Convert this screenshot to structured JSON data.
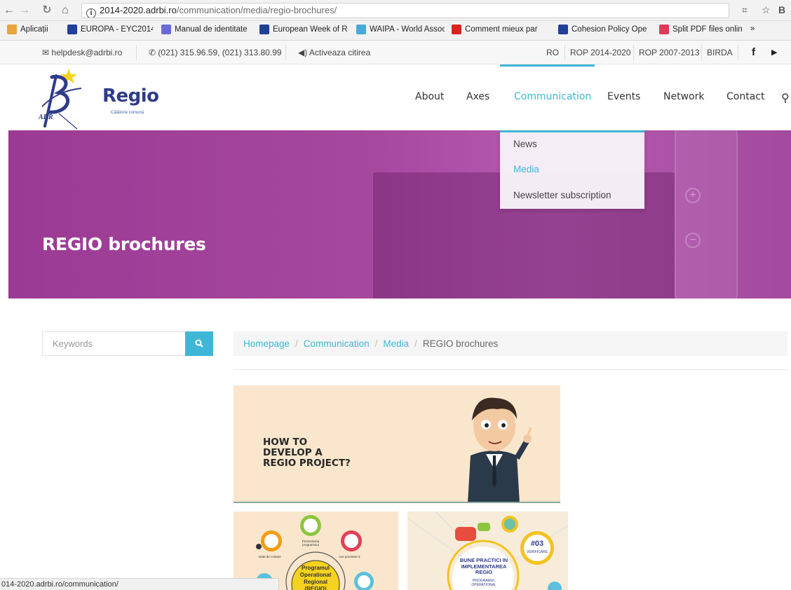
{
  "browser": {
    "url_host": "2014-2020.adrbi.ro",
    "url_path": "/communication/media/regio-brochures/",
    "bookmarks": [
      {
        "label": "Aplicații",
        "color": "#e8a53a"
      },
      {
        "label": "EUROPA - EYC2014 -",
        "color": "#1f3f99"
      },
      {
        "label": "Manual de identitate",
        "color": "#6b6bd6"
      },
      {
        "label": "European Week of R",
        "color": "#1f3f99"
      },
      {
        "label": "WAIPA - World Assoc",
        "color": "#4aa8d8"
      },
      {
        "label": "Comment mieux par",
        "color": "#d8231f"
      },
      {
        "label": "Cohesion Policy Ope",
        "color": "#1f3f99"
      },
      {
        "label": "Split PDF files online",
        "color": "#e03a5a"
      }
    ],
    "bookmarks_more": "»",
    "status_text": "014-2020.adrbi.ro/communication/"
  },
  "topbar": {
    "email": "helpdesk@adrbi.ro",
    "phone": "(021) 315.96.59, (021) 313.80.99",
    "read_aloud": "Activeaza citirea",
    "links": [
      "RO",
      "ROP 2014-2020",
      "ROP 2007-2013",
      "BIRDA"
    ]
  },
  "logo": {
    "brand": "Regio",
    "tagline": "Călătorie comună",
    "adr": "ADR"
  },
  "nav": {
    "items": [
      "About",
      "Axes",
      "Communication",
      "Events",
      "Network",
      "Contact"
    ],
    "active_index": 2
  },
  "dropdown": {
    "items": [
      "News",
      "Media",
      "Newsletter subscription"
    ],
    "active_index": 1
  },
  "hero": {
    "title": "REGIO brochures"
  },
  "search": {
    "placeholder": "Keywords"
  },
  "breadcrumb": {
    "items": [
      "Homepage",
      "Communication",
      "Media",
      "REGIO brochures"
    ],
    "separator": "/"
  },
  "cards": {
    "main_title": "HOW TO\nDEVELOP A\nREGIO PROJECT?",
    "card2_center": "Programul\nOperational\nRegional\n(REGIO)",
    "card2_labels": [
      "Prezentarea programului",
      "Axe prioritare 3",
      "Date de contact"
    ],
    "card3_title": "BUNE PRACTICI IN\nIMPLEMENTAREA\nREGIO",
    "card3_sub": "PROGRAMUL\nOPERATIONAL",
    "card3_badge_num": "#03",
    "card3_badge_label": "VERIFICARE"
  },
  "colors": {
    "accent": "#3fb6d6",
    "hero": "#a6479e",
    "card_bg": "#f9e6cc"
  }
}
